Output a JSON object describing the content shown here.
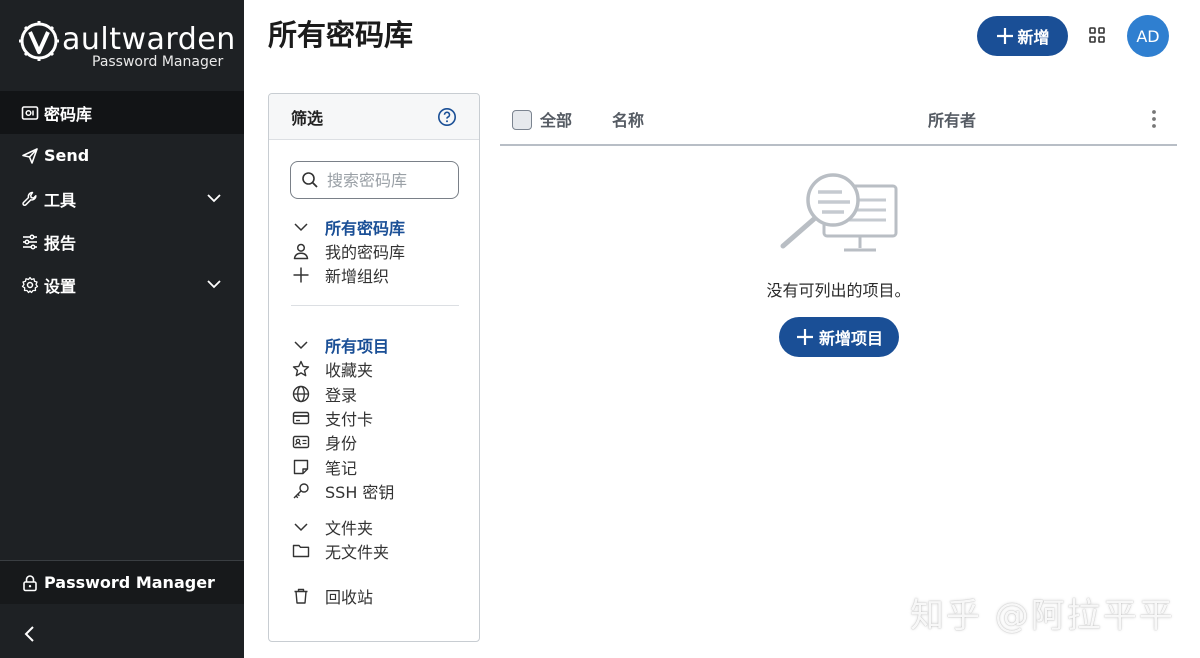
{
  "sidebar": {
    "logo": {
      "word": "aultwarden",
      "sub": "Password Manager"
    },
    "nav": [
      {
        "label": "密码库",
        "icon": "vault-icon",
        "active": true
      },
      {
        "label": "Send",
        "icon": "send-icon"
      },
      {
        "label": "工具",
        "icon": "wrench-icon",
        "expandable": true
      },
      {
        "label": "报告",
        "icon": "sliders-icon"
      },
      {
        "label": "设置",
        "icon": "gear-icon",
        "expandable": true
      }
    ],
    "bottom_label": "Password Manager"
  },
  "header": {
    "title": "所有密码库",
    "new_label": "新增",
    "avatar_initials": "AD"
  },
  "filter": {
    "title": "筛选",
    "search_placeholder": "搜索密码库",
    "vaults_head": "所有密码库",
    "my_vault": "我的密码库",
    "new_org": "新增组织",
    "items_head": "所有项目",
    "types": [
      "收藏夹",
      "登录",
      "支付卡",
      "身份",
      "笔记",
      "SSH 密钥"
    ],
    "folders_head": "文件夹",
    "no_folder": "无文件夹",
    "trash": "回收站"
  },
  "table": {
    "col_all": "全部",
    "col_name": "名称",
    "col_owner": "所有者"
  },
  "empty": {
    "message": "没有可列出的项目。",
    "add_item_label": "新增项目"
  },
  "watermark": "知乎 @阿拉平平",
  "colors": {
    "sidebar_bg": "#1e2124",
    "primary": "#1a4f96",
    "avatar": "#2f7fd0"
  }
}
